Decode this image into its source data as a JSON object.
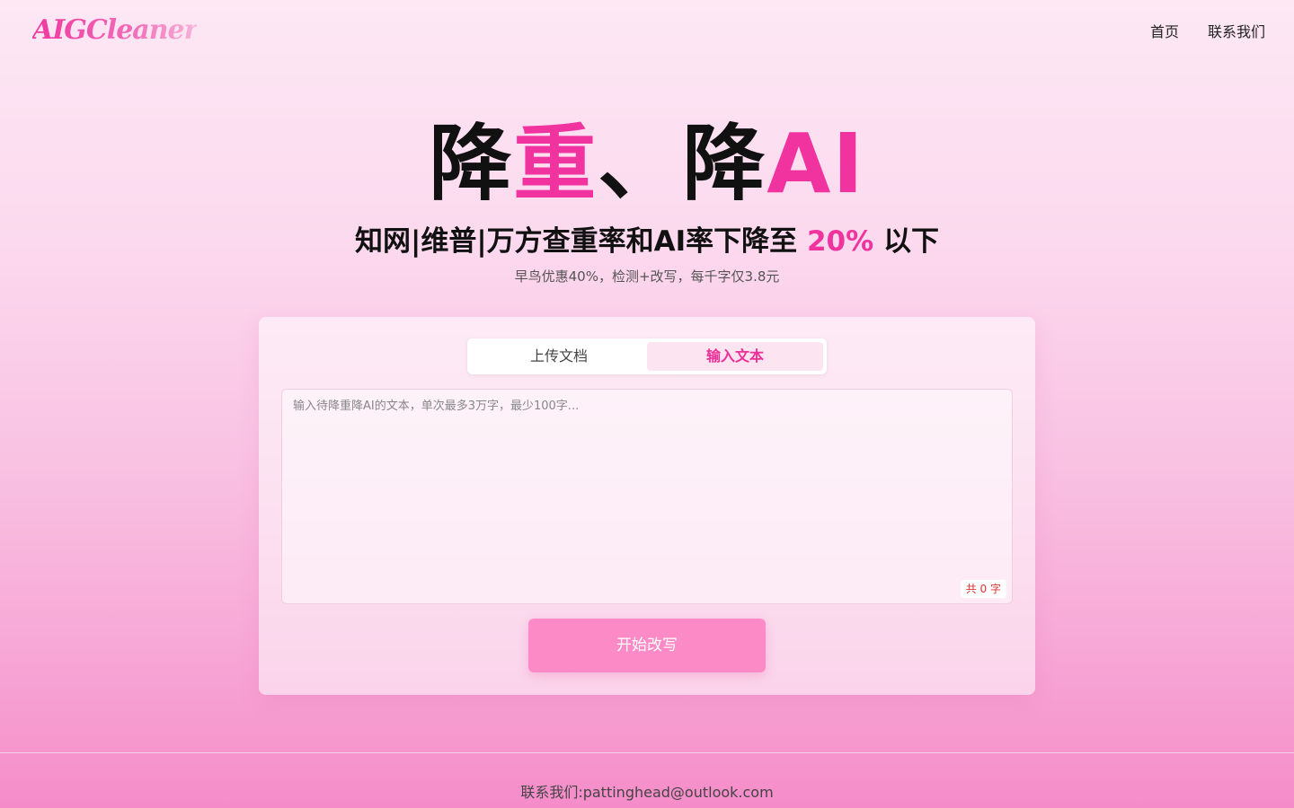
{
  "header": {
    "logo_text": "AIGCleaner",
    "nav": [
      {
        "label": "首页"
      },
      {
        "label": "联系我们"
      }
    ]
  },
  "hero": {
    "title_part1": "降",
    "title_part2": "重",
    "title_part3": "、降",
    "title_part4": "AI",
    "subtitle_prefix": "知网|维普|万方查重率和AI率下降至",
    "subtitle_highlight": "20%",
    "subtitle_suffix": "以下",
    "note": "早鸟优惠40%，检测+改写，每千字仅3.8元"
  },
  "tabs": [
    {
      "label": "上传文档",
      "active": false
    },
    {
      "label": "输入文本",
      "active": true
    }
  ],
  "editor": {
    "placeholder": "输入待降重降AI的文本，单次最多3万字，最少100字...",
    "value": "",
    "counter": "共 0 字"
  },
  "submit_label": "开始改写",
  "footer": {
    "contact": "联系我们:pattinghead@outlook.com"
  },
  "colors": {
    "accent": "#f0339f",
    "button": "#fb8ac6",
    "active_tab_bg": "#fde4f1"
  }
}
